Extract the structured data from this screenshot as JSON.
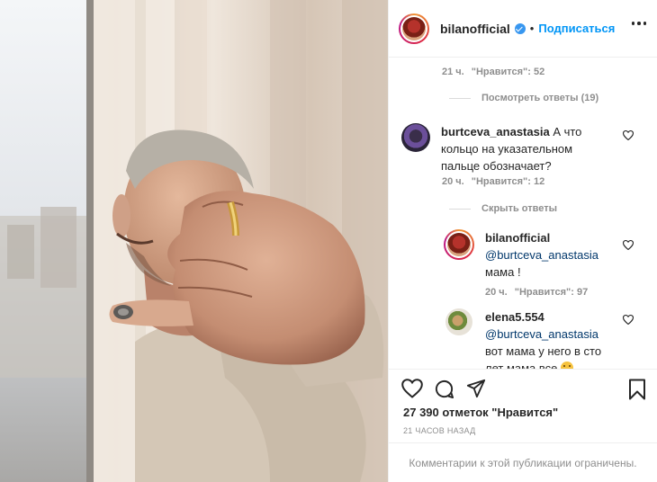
{
  "header": {
    "username": "bilanofficial",
    "follow_label": "Подписаться"
  },
  "comments_top": {
    "meta_time": "21 ч.",
    "meta_likes": "\"Нравится\": 52",
    "view_replies": "Посмотреть ответы (19)"
  },
  "comment_burtceva": {
    "user": "burtceva_anastasia",
    "text": "А что кольцо на указательном пальце обозначает?",
    "meta_time": "20 ч.",
    "meta_likes": "\"Нравится\": 12",
    "hide_replies": "Скрыть ответы"
  },
  "reply_bilan": {
    "user": "bilanofficial",
    "mention": "@burtceva_anastasia",
    "text": "мама !",
    "meta_time": "20 ч.",
    "meta_likes": "\"Нравится\": 97"
  },
  "reply_elena": {
    "user": "elena5.554",
    "mention": "@burtceva_anastasia",
    "text": "вот мама у него в сто лет мама все"
  },
  "post": {
    "likes": "27 390 отметок \"Нравится\"",
    "time_ago": "21 ЧАСОВ НАЗАД",
    "comments_restricted": "Комментарии к этой публикации ограничены."
  },
  "icons": [
    "heart-icon",
    "comment-icon",
    "share-icon",
    "bookmark-icon",
    "verified-icon",
    "more-options-icon"
  ],
  "colors": {
    "accent": "#0095f6",
    "muted": "#8e8e8e",
    "text": "#262626",
    "mention": "#00376b"
  }
}
